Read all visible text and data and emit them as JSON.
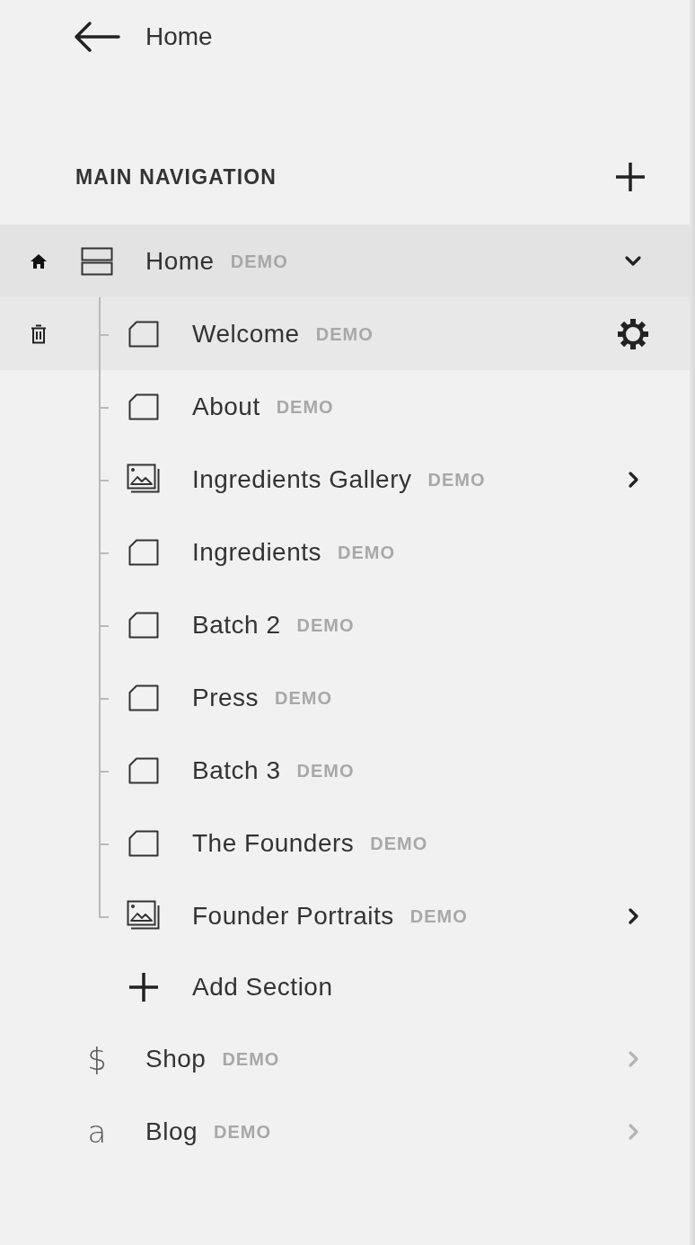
{
  "back_link": {
    "label": "Home"
  },
  "section": {
    "title": "MAIN NAVIGATION"
  },
  "nav_items": [
    {
      "kind": "index",
      "label": "Home",
      "badge": "DEMO",
      "homepage": true,
      "selected": true,
      "expanded": true,
      "children": [
        {
          "kind": "page",
          "label": "Welcome",
          "badge": "DEMO",
          "selected": true
        },
        {
          "kind": "page",
          "label": "About",
          "badge": "DEMO",
          "selected": false
        },
        {
          "kind": "gallery",
          "label": "Ingredients Gallery",
          "badge": "DEMO",
          "selected": false
        },
        {
          "kind": "page",
          "label": "Ingredients",
          "badge": "DEMO",
          "selected": false
        },
        {
          "kind": "page",
          "label": "Batch 2",
          "badge": "DEMO",
          "selected": false
        },
        {
          "kind": "page",
          "label": "Press",
          "badge": "DEMO",
          "selected": false
        },
        {
          "kind": "page",
          "label": "Batch 3",
          "badge": "DEMO",
          "selected": false
        },
        {
          "kind": "page",
          "label": "The Founders",
          "badge": "DEMO",
          "selected": false
        },
        {
          "kind": "gallery",
          "label": "Founder Portraits",
          "badge": "DEMO",
          "selected": false
        }
      ],
      "add_label": "Add Section"
    },
    {
      "kind": "products",
      "glyph": "$",
      "label": "Shop",
      "badge": "DEMO",
      "homepage": false,
      "selected": false,
      "expanded": false
    },
    {
      "kind": "blog",
      "glyph": "a",
      "label": "Blog",
      "badge": "DEMO",
      "homepage": false,
      "selected": false,
      "expanded": false
    }
  ]
}
